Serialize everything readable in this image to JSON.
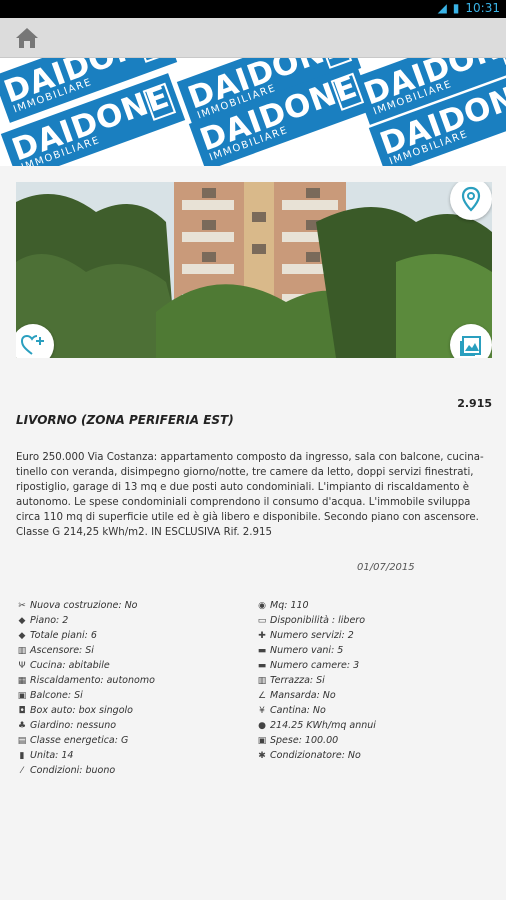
{
  "status_bar": {
    "time": "10:31"
  },
  "banner": {
    "brand": "DAIDONE",
    "subtitle": "IMMOBILIARE"
  },
  "listing": {
    "price": "2.915",
    "city": "LIVORNO (ZONA PERIFERIA EST)",
    "description": "Euro 250.000 Via Costanza: appartamento composto da ingresso, sala con balcone, cucina-tinello con veranda, disimpegno giorno/notte, tre camere da letto, doppi servizi finestrati, ripostiglio, garage di 13 mq e due posti auto condominiali. L'impianto di riscaldamento è autonomo. Le spese condominiali comprendono il consumo d'acqua. L'immobile sviluppa circa 110 mq di superficie utile ed è già libero e disponibile. Secondo piano con ascensore. Classe G 214,25 kWh/m2. IN ESCLUSIVA Rif. 2.915",
    "date": "01/07/2015"
  },
  "features_left": [
    {
      "icon": "tools-icon",
      "glyph": "✂",
      "label": "Nuova costruzione:  No"
    },
    {
      "icon": "floor-icon",
      "glyph": "◆",
      "label": "Piano:  2"
    },
    {
      "icon": "floors-icon",
      "glyph": "◆",
      "label": "Totale piani:  6"
    },
    {
      "icon": "elevator-icon",
      "glyph": "▥",
      "label": "Ascensore:  Si"
    },
    {
      "icon": "kitchen-icon",
      "glyph": "Ψ",
      "label": "Cucina:  abitabile"
    },
    {
      "icon": "heating-icon",
      "glyph": "▦",
      "label": "Riscaldamento:  autonomo"
    },
    {
      "icon": "balcony-icon",
      "glyph": "▣",
      "label": "Balcone:  Si"
    },
    {
      "icon": "car-icon",
      "glyph": "◘",
      "label": "Box auto:  box singolo"
    },
    {
      "icon": "garden-icon",
      "glyph": "♣",
      "label": "Giardino:  nessuno"
    },
    {
      "icon": "energy-icon",
      "glyph": "▤",
      "label": "Classe energetica:  G"
    },
    {
      "icon": "units-icon",
      "glyph": "▮",
      "label": "Unita:  14"
    },
    {
      "icon": "condition-icon",
      "glyph": "⁄",
      "label": "Condizioni:  buono"
    }
  ],
  "features_right": [
    {
      "icon": "area-icon",
      "glyph": "◉",
      "label": "Mq:  110"
    },
    {
      "icon": "availability-icon",
      "glyph": "▭",
      "label": "Disponibilità  :  libero"
    },
    {
      "icon": "bath-icon",
      "glyph": "✚",
      "label": "Numero servizi:  2"
    },
    {
      "icon": "rooms-icon",
      "glyph": "▬",
      "label": "Numero vani:  5"
    },
    {
      "icon": "bed-icon",
      "glyph": "▬",
      "label": "Numero camere:  3"
    },
    {
      "icon": "terrace-icon",
      "glyph": "▥",
      "label": "Terrazza:  Si"
    },
    {
      "icon": "attic-icon",
      "glyph": "∠",
      "label": "Mansarda:  No"
    },
    {
      "icon": "cellar-icon",
      "glyph": "¥",
      "label": "Cantina:  No"
    },
    {
      "icon": "energy-index-icon",
      "glyph": "●",
      "label": "214.25 KWh/mq annui"
    },
    {
      "icon": "expenses-icon",
      "glyph": "▣",
      "label": "Spese:  100.00"
    },
    {
      "icon": "ac-icon",
      "glyph": "✱",
      "label": "Condizionatore:  No"
    }
  ],
  "colors": {
    "brand_blue": "#1a7fc0",
    "accent_teal": "#2a9fbf"
  }
}
